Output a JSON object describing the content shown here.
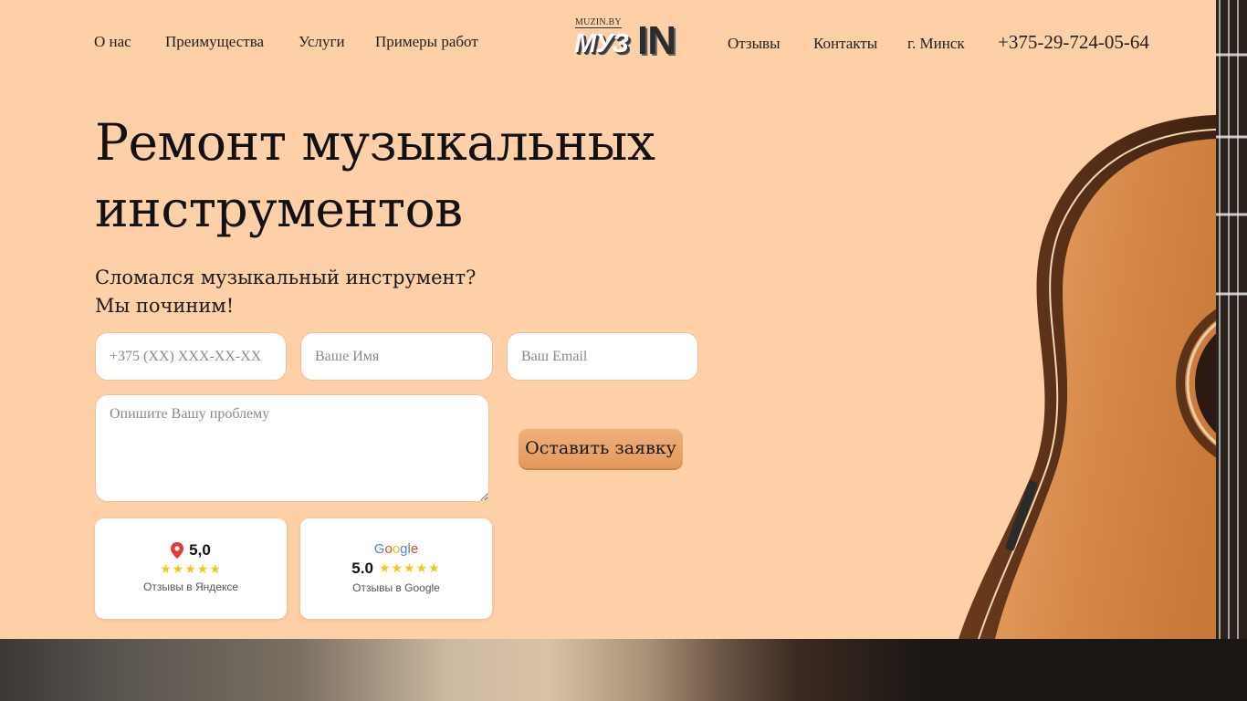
{
  "header": {
    "nav_left": [
      "О нас",
      "Преимущества",
      "Услуги",
      "Примеры работ"
    ],
    "logo": {
      "small": "MUZIN.BY",
      "brand_a": "МУЗ",
      "brand_b": "IN"
    },
    "nav_right": [
      "Отзывы",
      "Контакты",
      "г. Минск"
    ],
    "phone": "+375-29-724-05-64"
  },
  "hero": {
    "title_line1": "Ремонт музыкальных",
    "title_line2": "инструментов",
    "subtitle_line1": "Сломался музыкальный инструмент?",
    "subtitle_line2": "Мы починим!"
  },
  "form": {
    "phone_placeholder": "+375 (XX) XXX-XX-XX",
    "name_placeholder": "Ваше Имя",
    "email_placeholder": "Ваш Email",
    "problem_placeholder": "Опишите Вашу проблему",
    "submit_label": "Оставить заявку"
  },
  "reviews": {
    "yandex": {
      "rating": "5,0",
      "stars": "★★★★★",
      "label": "Отзывы в Яндексе",
      "icon": "map-pin-icon"
    },
    "google": {
      "logo": "Google",
      "rating": "5.0",
      "stars": "★★★★★",
      "label": "Отзывы в Google"
    }
  },
  "colors": {
    "background": "#fdd0a8",
    "button": "#e9a469",
    "star": "#f5c518"
  }
}
